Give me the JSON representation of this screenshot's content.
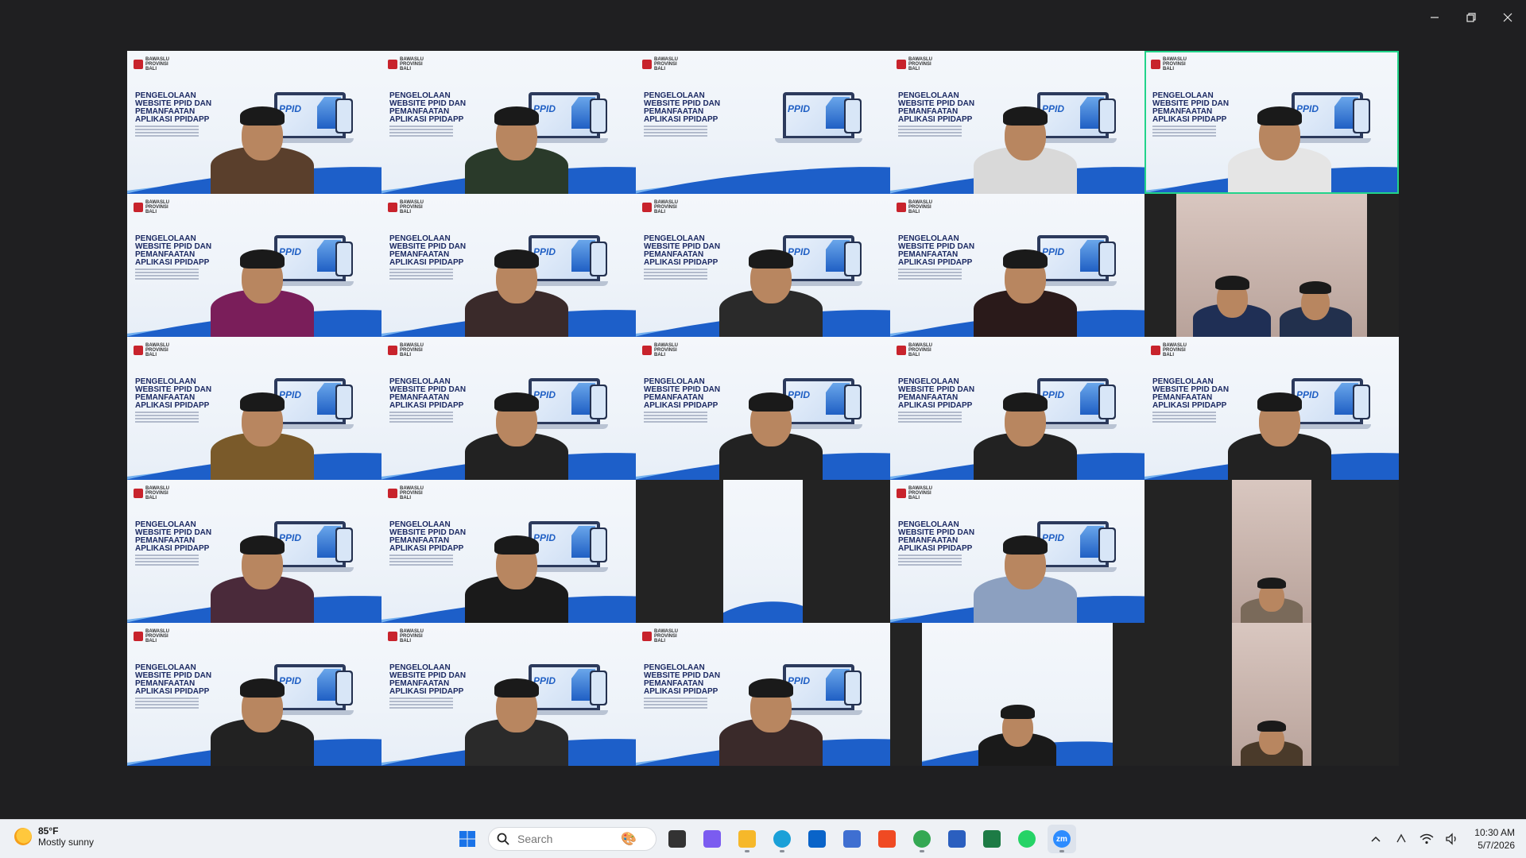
{
  "window": {
    "controls": [
      {
        "name": "minimize-button",
        "icon": "minimize-icon"
      },
      {
        "name": "restore-button",
        "icon": "restore-icon"
      },
      {
        "name": "close-button",
        "icon": "close-icon"
      }
    ]
  },
  "slide": {
    "org": "BAWASLU PROVINSI BALI",
    "title": "PENGELOLAAN WEBSITE PPID DAN PEMANFAATAN APLIKASI PPIDAPP",
    "screen_label": "PPID"
  },
  "meeting": {
    "active_speaker_color": "#22d38a"
  },
  "taskbar": {
    "weather": {
      "temp": "85°F",
      "condition": "Mostly sunny"
    },
    "search_placeholder": "Search",
    "apps": [
      {
        "name": "start-button",
        "icon": "windows-logo-icon",
        "color": "#1a73e8"
      },
      {
        "name": "task-view",
        "icon": "task-view-icon",
        "color": "#333333"
      },
      {
        "name": "copilot",
        "icon": "copilot-icon",
        "color": "#7b5cf0"
      },
      {
        "name": "file-explorer",
        "icon": "folder-icon",
        "color": "#f6b82a"
      },
      {
        "name": "edge",
        "icon": "edge-icon",
        "color": "#1aa0d8"
      },
      {
        "name": "outlook",
        "icon": "outlook-icon",
        "color": "#0a64c9"
      },
      {
        "name": "ms-store",
        "icon": "store-icon",
        "color": "#3f6fd1"
      },
      {
        "name": "brave",
        "icon": "brave-icon",
        "color": "#f04a23"
      },
      {
        "name": "chrome",
        "icon": "chrome-icon",
        "color": "#34a853"
      },
      {
        "name": "word",
        "icon": "word-icon",
        "color": "#2b5fbf"
      },
      {
        "name": "excel",
        "icon": "excel-icon",
        "color": "#1d7b45"
      },
      {
        "name": "whatsapp",
        "icon": "whatsapp-icon",
        "color": "#25d366"
      },
      {
        "name": "zoom",
        "icon": "zoom-icon",
        "color": "#2d8cff",
        "label": "zm"
      }
    ],
    "tray": {
      "time": "10:30 AM",
      "date": "5/7/2026"
    }
  }
}
